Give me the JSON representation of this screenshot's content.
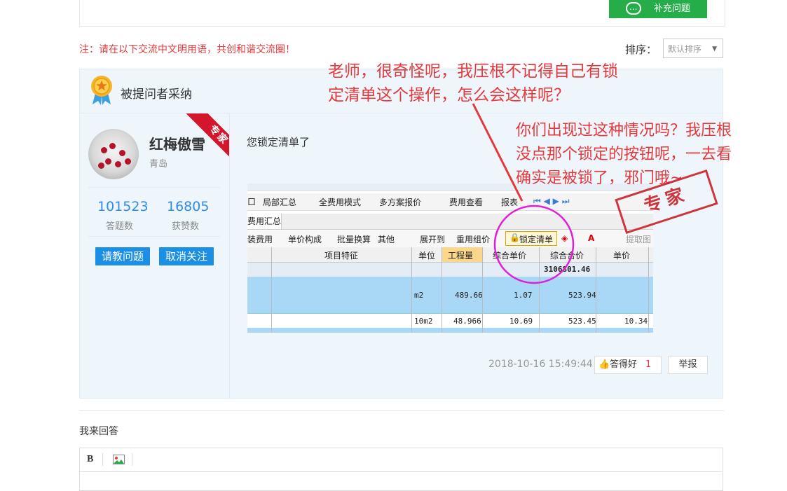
{
  "top": {
    "supplement_label": "补充问题"
  },
  "notice": "注：请在以下交流中文明用语，共创和谐交流圈！",
  "sort": {
    "label": "排序：",
    "value": "默认排序"
  },
  "answer": {
    "adopted_label": "被提问者采纳",
    "expert_badge": "专家",
    "user": {
      "name": "红梅傲雪",
      "city": "青岛"
    },
    "stats": [
      {
        "value": "101523",
        "label": "答题数"
      },
      {
        "value": "16805",
        "label": "获赞数"
      }
    ],
    "buttons": {
      "ask": "请教问题",
      "unfollow": "取消关注"
    },
    "text": "您锁定清单了",
    "date": "2018-10-16 15:49:44",
    "good_label": "答得好",
    "good_count": "1",
    "report_label": "举报"
  },
  "screenshot": {
    "toolbar1": [
      "局部汇总",
      "全费用模式",
      "多方案报价",
      "费用查看",
      "报表"
    ],
    "tab": "费用汇总",
    "toolbar2": [
      "装费用",
      "单价构成",
      "批量换算",
      "其他",
      "展开到",
      "重用组价",
      "锁定清单",
      "提取图"
    ],
    "columns": [
      "项目特征",
      "单位",
      "工程量",
      "综合单价",
      "综合合价",
      "单价"
    ],
    "sum_value": "3106801.46",
    "row1": {
      "unit": "m2",
      "qty": "489.66",
      "unit_price": "1.07",
      "total": "523.94"
    },
    "row2": {
      "unit": "10m2",
      "qty": "48.966",
      "unit_price": "10.69",
      "total": "523.45",
      "price": "10.34"
    }
  },
  "overlay": {
    "question_lines": [
      "老师，很奇怪呢，我压根不记得自己有锁",
      "定清单这个操作，怎么会这样呢？"
    ],
    "side_lines": [
      "你们出现过这种情况吗？我压根",
      "没点那个锁定的按钮呢，一去看",
      "确实是被锁了，邪门哦~"
    ],
    "stamp": "专家"
  },
  "reply": {
    "label": "我来回答",
    "bold": "B"
  },
  "colors": {
    "accent_green": "#25ad4a",
    "notice_red": "#e4393c",
    "link_blue": "#2d8cf0",
    "button_blue": "#1a8fe5",
    "highlight_magenta": "#e020d8"
  }
}
